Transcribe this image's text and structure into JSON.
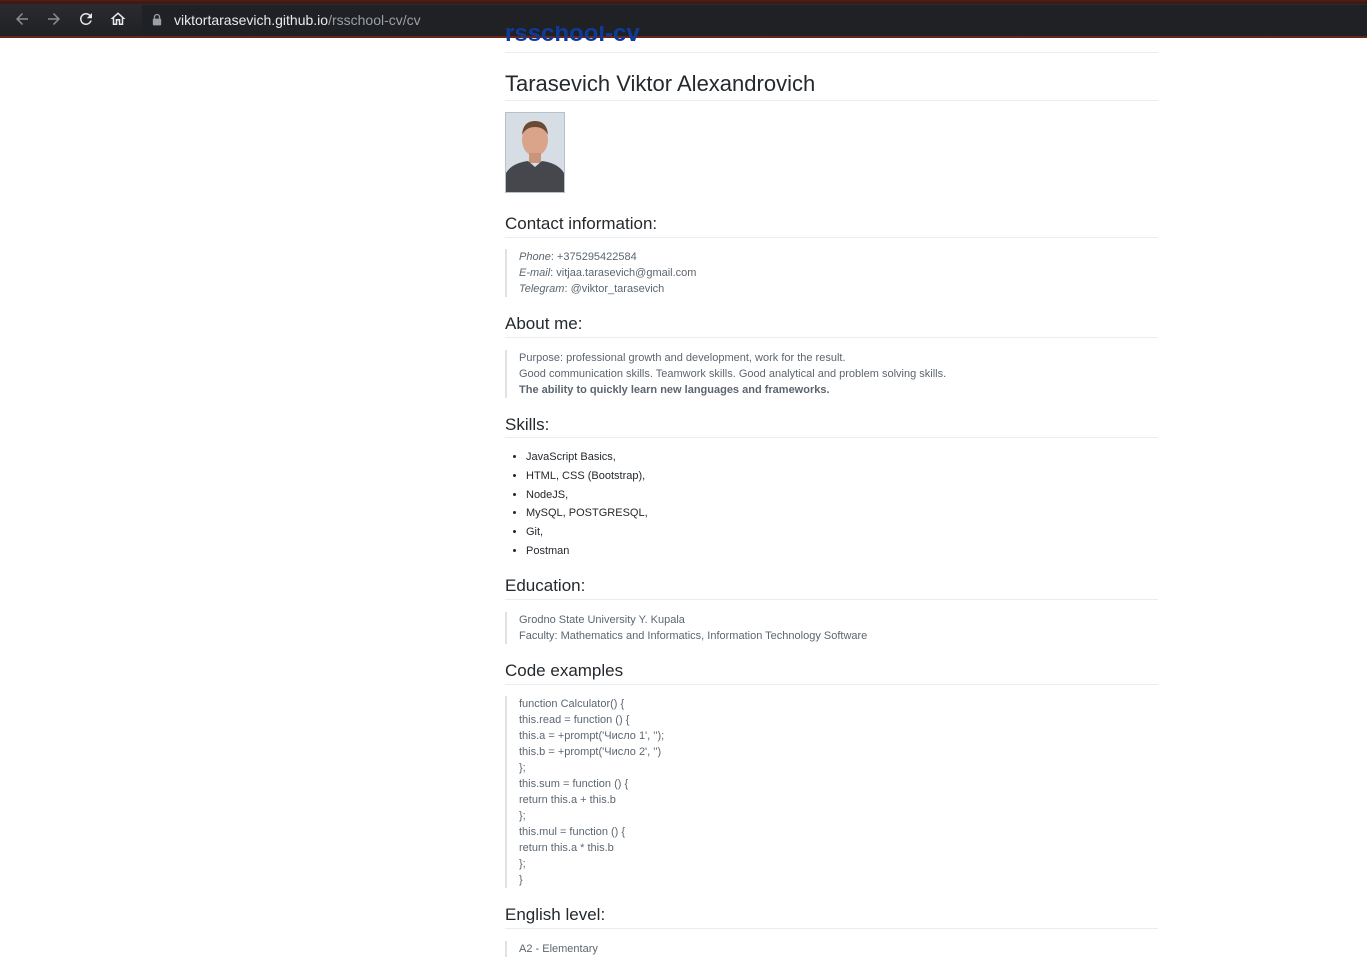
{
  "browser": {
    "url_host": "viktortarasevich.github.io",
    "url_path": "/rsschool-cv/cv"
  },
  "page": {
    "prev_title": "rsschool-cv",
    "name": "Tarasevich Viktor Alexandrovich",
    "contact": {
      "title": "Contact information:",
      "phone_label": "Phone",
      "phone_value": ": +375295422584",
      "email_label": "E-mail",
      "email_value": ": vitjaa.tarasevich@gmail.com",
      "telegram_label": "Telegram",
      "telegram_value": ": @viktor_tarasevich"
    },
    "about": {
      "title": "About me:",
      "lines": [
        "Purpose: professional growth and development, work for the result.",
        "Good communication skills. Teamwork skills. Good analytical and problem solving skills.",
        "The ability to quickly learn new languages and frameworks."
      ]
    },
    "skills": {
      "title": "Skills:",
      "items": [
        "JavaScript Basics,",
        "HTML, CSS (Bootstrap),",
        "NodeJS,",
        "MySQL, POSTGRESQL,",
        "Git,",
        "Postman"
      ]
    },
    "education": {
      "title": "Education:",
      "lines": [
        "Grodno State University Y. Kupala",
        "Faculty: Mathematics and Informatics, Information Technology Software"
      ]
    },
    "code": {
      "title": "Code examples",
      "lines": [
        "function Calculator() {",
        "this.read = function () {",
        "this.a = +prompt('Число 1', '');",
        "this.b = +prompt('Число 2', '')",
        "};",
        "this.sum = function () {",
        "return this.a + this.b",
        "};",
        "this.mul = function () {",
        "return this.a * this.b",
        "};",
        "}"
      ]
    },
    "english": {
      "title": "English level:",
      "value": "A2 - Elementary"
    }
  }
}
